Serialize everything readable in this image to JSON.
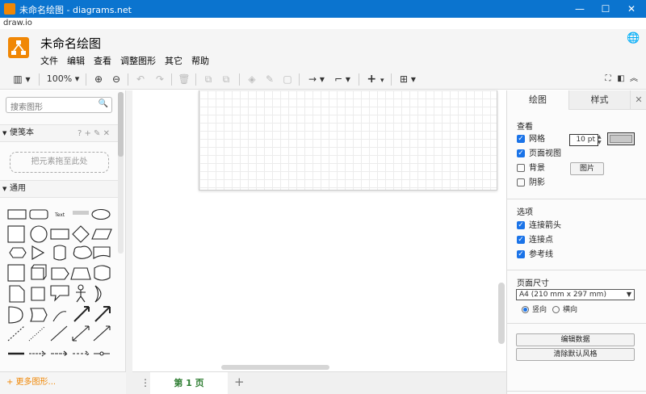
{
  "window": {
    "title": "未命名绘图 - diagrams.net",
    "controls": {
      "minimize": "—",
      "maximize": "☐",
      "close": "✕"
    }
  },
  "urlbar": {
    "text": "draw.io"
  },
  "header": {
    "doc_title": "未命名绘图",
    "menu": [
      "文件",
      "编辑",
      "查看",
      "调整图形",
      "其它",
      "帮助"
    ],
    "globe_icon": "globe-icon"
  },
  "toolbar": {
    "zoom": "100%",
    "items": [
      "view-icon",
      "zoom-in-icon",
      "zoom-out-icon",
      "undo-icon",
      "redo-icon",
      "delete-icon",
      "to-front-icon",
      "to-back-icon",
      "fill-color-icon",
      "line-color-icon",
      "shadow-icon",
      "connection-icon",
      "waypoint-icon",
      "insert-icon",
      "table-icon",
      "fullscreen-icon",
      "format-panel-icon",
      "collapse-icon"
    ]
  },
  "sidebar": {
    "search_placeholder": "搜索图形",
    "scratchpad_title": "便笺本",
    "scratchpad_actions": "? + ✎ ✕",
    "dropzone_text": "把元素拖至此处",
    "general_title": "通用",
    "text_shape_label": "Text",
    "more_shapes": "+ 更多图形..."
  },
  "canvas": {
    "page_tab": "第 1 页",
    "add_page": "+",
    "page_menu": "⋮"
  },
  "format_panel": {
    "tab_diagram": "绘图",
    "tab_style": "样式",
    "close": "✕",
    "view_title": "查看",
    "grid_label": "网格",
    "grid_checked": true,
    "grid_size": "10 pt",
    "page_view_label": "页面视图",
    "page_view_checked": true,
    "background_label": "背景",
    "background_checked": false,
    "image_button": "图片",
    "shadow_label": "阴影",
    "shadow_checked": false,
    "options_title": "选项",
    "connection_arrows_label": "连接箭头",
    "connection_points_label": "连接点",
    "guides_label": "参考线",
    "paper_size_title": "页面尺寸",
    "paper_size_value": "A4 (210 mm x 297 mm)",
    "orientation_portrait": "竖向",
    "orientation_landscape": "横向",
    "orientation_selected": "portrait",
    "edit_data_button": "编辑数据",
    "clear_style_button": "清除默认风格",
    "grid_color": "#c8c8c8",
    "accent_color": "#1a73e8"
  },
  "colors": {
    "titlebar": "#0b74cf",
    "brand": "#f08705",
    "page_tab_text": "#2e7d32"
  }
}
